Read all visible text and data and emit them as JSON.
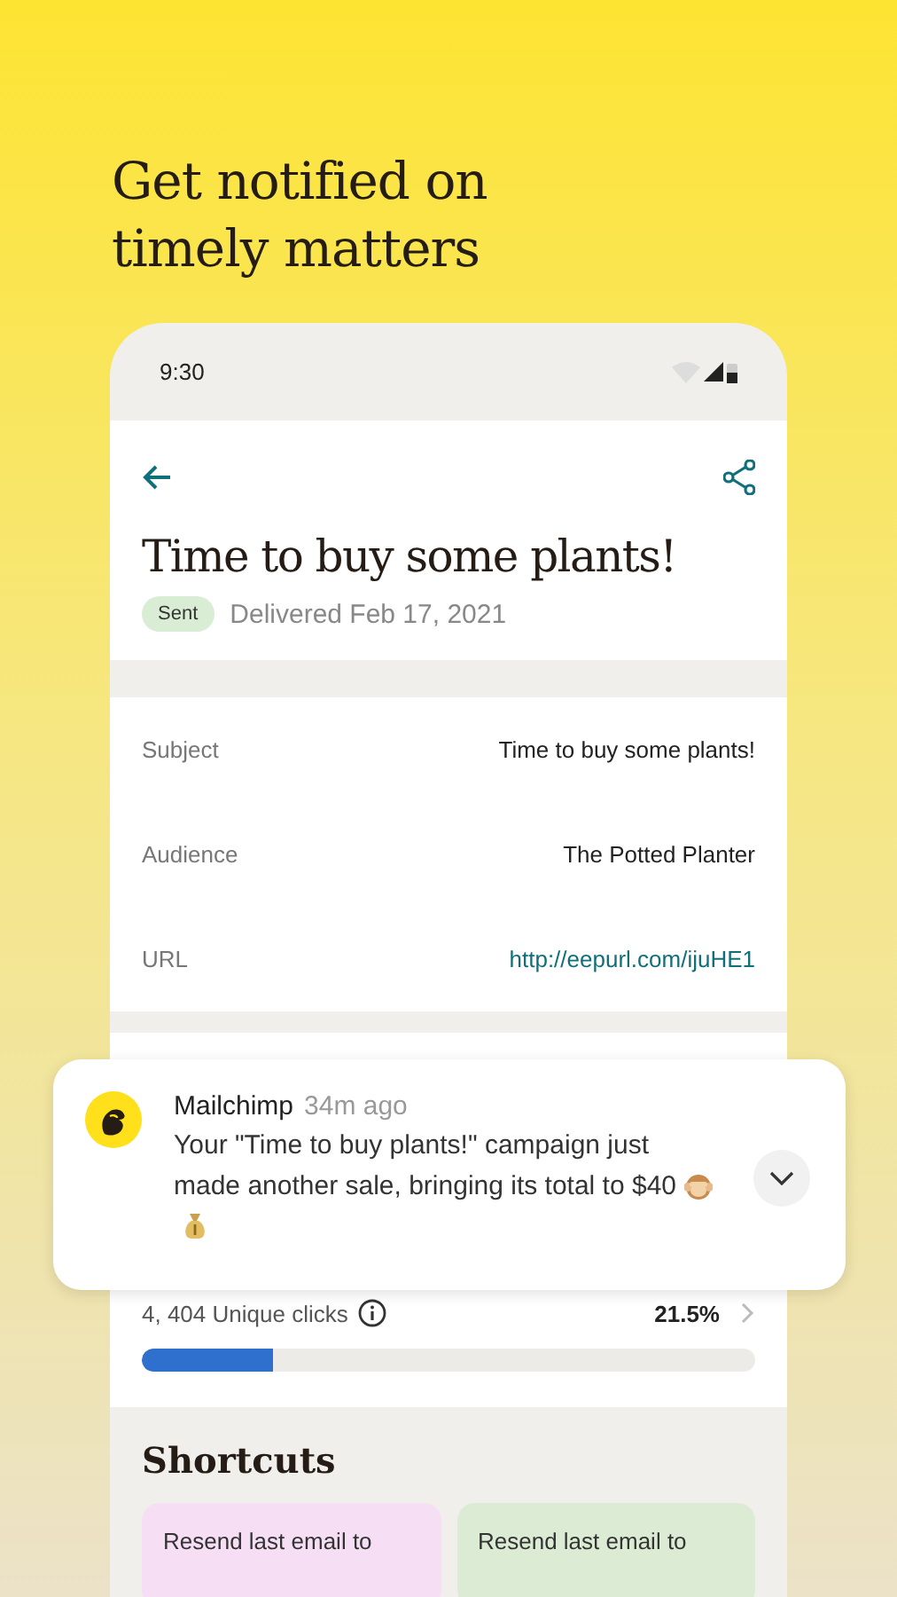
{
  "headline": "Get notified on timely matters",
  "status_bar": {
    "time": "9:30"
  },
  "campaign": {
    "title": "Time to buy some plants!",
    "status": "Sent",
    "delivered": "Delivered Feb 17, 2021"
  },
  "details": [
    {
      "label": "Subject",
      "value": "Time to buy some plants!",
      "kind": "text"
    },
    {
      "label": "Audience",
      "value": "The Potted Planter",
      "kind": "text"
    },
    {
      "label": "URL",
      "value": "http://eepurl.com/ijuHE1",
      "kind": "link"
    }
  ],
  "notification": {
    "app": "Mailchimp",
    "time": "34m ago",
    "message": "Your \"Time to buy plants!\" campaign just made another sale, bringing its total to $40"
  },
  "clicks": {
    "label": "4, 404 Unique clicks",
    "percent": "21.5%",
    "level": 0.215
  },
  "shortcuts": {
    "title": "Shortcuts",
    "items": [
      {
        "label": "Resend last email to",
        "color": "#f6def5"
      },
      {
        "label": "Resend last email to",
        "color": "#dcebd3"
      }
    ]
  }
}
